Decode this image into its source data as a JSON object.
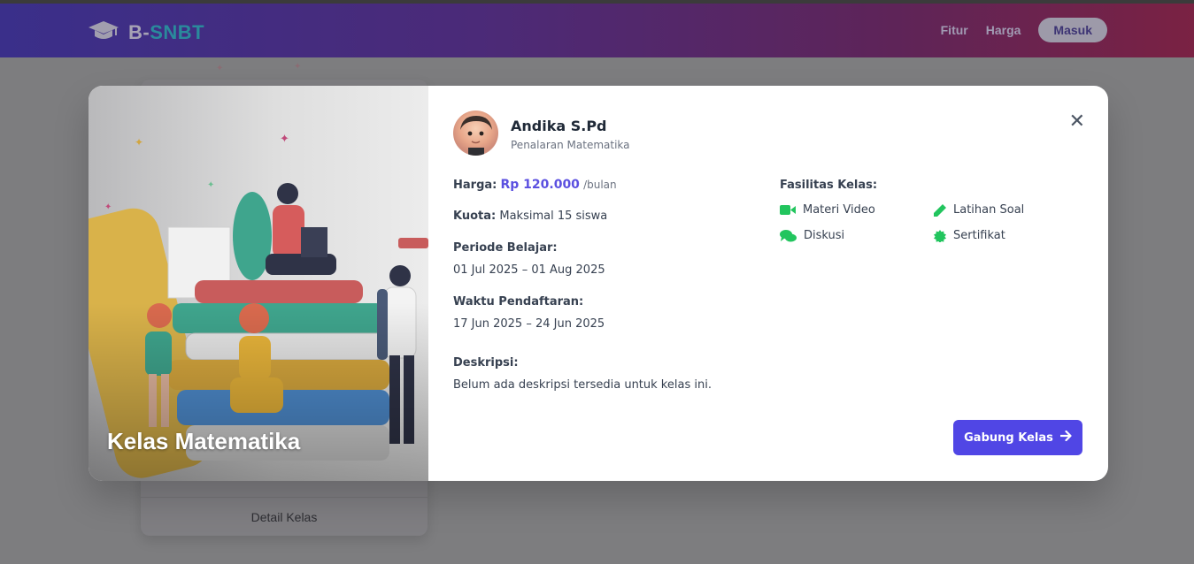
{
  "header": {
    "logo_prefix": "B-",
    "logo_accent": "SNBT",
    "nav": [
      "Fitur",
      "Harga"
    ],
    "login_label": "Masuk"
  },
  "background_card": {
    "detail_label": "Detail Kelas"
  },
  "modal": {
    "hero_title": "Kelas Matematika",
    "close_symbol": "✕",
    "teacher": {
      "name": "Andika S.Pd",
      "subject": "Penalaran Matematika"
    },
    "price": {
      "label": "Harga:",
      "value": "Rp 120.000",
      "unit": "/bulan"
    },
    "quota": {
      "label": "Kuota:",
      "value": "Maksimal 15 siswa"
    },
    "study_period": {
      "label": "Periode Belajar:",
      "value": "01 Jul 2025 – 01 Aug 2025"
    },
    "registration_time": {
      "label": "Waktu Pendaftaran:",
      "value": "17 Jun 2025 – 24 Jun 2025"
    },
    "description": {
      "label": "Deskripsi:",
      "value": "Belum ada deskripsi tersedia untuk kelas ini."
    },
    "facilities": {
      "title": "Fasilitas Kelas:",
      "items": [
        {
          "label": "Materi Video",
          "icon": "video-icon"
        },
        {
          "label": "Latihan Soal",
          "icon": "pencil-icon"
        },
        {
          "label": "Diskusi",
          "icon": "comments-icon"
        },
        {
          "label": "Sertifikat",
          "icon": "certificate-icon"
        }
      ]
    },
    "join_button": "Gabung Kelas"
  },
  "colors": {
    "primary": "#5046e5",
    "facility_icon": "#22c55e",
    "header_start": "#3a2f8a",
    "header_end": "#7a2243"
  }
}
